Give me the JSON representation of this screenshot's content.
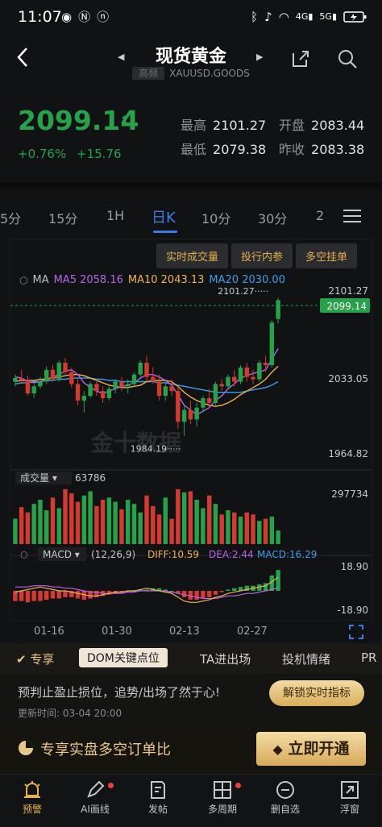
{
  "status_bar": {
    "time": "11:07",
    "left_icons": [
      "eye-icon",
      "nfc-icon",
      "n-icon"
    ],
    "right_icons": [
      "bluetooth-icon",
      "mute-icon",
      "wifi-icon",
      "signal-4g-icon",
      "signal-5g-icon",
      "battery-charging-icon"
    ]
  },
  "header": {
    "title": "现货黄金",
    "tag": "高频",
    "symbol": "XAUUSD.GOODS"
  },
  "quote": {
    "price": "2099.14",
    "change_pct": "+0.76%",
    "change_abs": "+15.76",
    "high_label": "最高",
    "high": "2101.27",
    "open_label": "开盘",
    "open": "2083.44",
    "low_label": "最低",
    "low": "2079.38",
    "prev_close_label": "昨收",
    "prev_close": "2083.38"
  },
  "period_tabs": [
    {
      "label": "5分"
    },
    {
      "label": "15分"
    },
    {
      "label": "1H"
    },
    {
      "label": "日K",
      "active": true
    },
    {
      "label": "10分"
    },
    {
      "label": "30分"
    },
    {
      "label": "2"
    }
  ],
  "chart_chips": [
    "实时成交量",
    "投行内参",
    "多空挂单"
  ],
  "ma_legend": {
    "name": "MA",
    "ma5": "MA5 2058.16",
    "ma10": "MA10 2043.13",
    "ma20": "MA20 2030.00"
  },
  "price_axis": {
    "top": "2101.27",
    "mid": "2033.05",
    "bottom": "1964.82",
    "current": "2099.14",
    "high_marker": "2101.27",
    "low_marker": "1984.19"
  },
  "watermark": "金十数据",
  "volume": {
    "selector": "成交量",
    "value": "63786",
    "axis_max": "297734"
  },
  "macd": {
    "selector": "MACD",
    "params": "(12,26,9)",
    "diff": "DIFF:10.59",
    "dea": "DEA:2.44",
    "macd": "MACD:16.29",
    "axis_top": "18.90",
    "axis_bottom": "-18.90"
  },
  "x_axis": [
    "01-16",
    "01-30",
    "02-13",
    "02-27"
  ],
  "exclusive_bar": {
    "label": "专享",
    "active": "DOM关键点位",
    "items": [
      "TA进出场",
      "投机情绪",
      "PR"
    ]
  },
  "notice": {
    "text": "预判止盈止损位，追势/出场了然于心!",
    "time": "更新时间: 03-04 20:00",
    "button": "解锁实时指标"
  },
  "promo": {
    "text": "专享实盘多空订单比",
    "button": "立即开通"
  },
  "bottom_nav": [
    {
      "label": "预警",
      "icon": "alarm-icon",
      "active": true
    },
    {
      "label": "AI画线",
      "icon": "pen-icon",
      "dot": true
    },
    {
      "label": "发帖",
      "icon": "post-icon"
    },
    {
      "label": "多周期",
      "icon": "grid-icon",
      "dot": true
    },
    {
      "label": "删自选",
      "icon": "minus-circle-icon"
    },
    {
      "label": "浮窗",
      "icon": "float-window-icon"
    }
  ],
  "colors": {
    "up": "#25a24a",
    "down": "#d43a2f",
    "accent": "#3b7be8",
    "gold": "#e4b04f",
    "ma5": "#b765e8",
    "ma10": "#f0b24a",
    "ma20": "#3aa0e8"
  },
  "chart_data": {
    "type": "candlestick",
    "price_range": [
      1964.82,
      2101.27
    ],
    "candles": [
      [
        2030,
        2036,
        2026,
        2033
      ],
      [
        2033,
        2040,
        2028,
        2031
      ],
      [
        2031,
        2035,
        2018,
        2020
      ],
      [
        2020,
        2028,
        2016,
        2026
      ],
      [
        2026,
        2034,
        2024,
        2030
      ],
      [
        2030,
        2043,
        2028,
        2040
      ],
      [
        2040,
        2044,
        2030,
        2032
      ],
      [
        2032,
        2048,
        2030,
        2046
      ],
      [
        2046,
        2050,
        2035,
        2038
      ],
      [
        2038,
        2042,
        2025,
        2028
      ],
      [
        2028,
        2032,
        2010,
        2014
      ],
      [
        2014,
        2022,
        2004,
        2018
      ],
      [
        2018,
        2030,
        2016,
        2028
      ],
      [
        2028,
        2032,
        2018,
        2022
      ],
      [
        2022,
        2026,
        2012,
        2016
      ],
      [
        2016,
        2026,
        2014,
        2024
      ],
      [
        2024,
        2032,
        2020,
        2030
      ],
      [
        2030,
        2034,
        2022,
        2026
      ],
      [
        2026,
        2032,
        2020,
        2028
      ],
      [
        2028,
        2038,
        2026,
        2036
      ],
      [
        2036,
        2048,
        2034,
        2046
      ],
      [
        2046,
        2052,
        2030,
        2034
      ],
      [
        2034,
        2042,
        2028,
        2030
      ],
      [
        2030,
        2036,
        2014,
        2018
      ],
      [
        2018,
        2030,
        2014,
        2026
      ],
      [
        2026,
        2032,
        2018,
        2022
      ],
      [
        2022,
        2026,
        1990,
        1996
      ],
      [
        1996,
        2010,
        1984,
        2006
      ],
      [
        2006,
        2014,
        1994,
        1998
      ],
      [
        1998,
        2012,
        1992,
        2008
      ],
      [
        2008,
        2018,
        2004,
        2016
      ],
      [
        2016,
        2024,
        2008,
        2012
      ],
      [
        2012,
        2030,
        2010,
        2028
      ],
      [
        2028,
        2032,
        2022,
        2026
      ],
      [
        2026,
        2036,
        2024,
        2034
      ],
      [
        2034,
        2040,
        2026,
        2030
      ],
      [
        2030,
        2044,
        2028,
        2042
      ],
      [
        2042,
        2046,
        2030,
        2034
      ],
      [
        2034,
        2040,
        2028,
        2032
      ],
      [
        2032,
        2048,
        2030,
        2046
      ],
      [
        2046,
        2052,
        2038,
        2044
      ],
      [
        2044,
        2082,
        2042,
        2080
      ],
      [
        2083,
        2101,
        2079,
        2099
      ]
    ],
    "ma5": [
      2034,
      2033,
      2030,
      2029,
      2030,
      2032,
      2034,
      2036,
      2039,
      2040,
      2036,
      2029,
      2025,
      2022,
      2020,
      2022,
      2024,
      2026,
      2027,
      2029,
      2033,
      2036,
      2036,
      2034,
      2031,
      2027,
      2019,
      2010,
      2006,
      2002,
      2005,
      2008,
      2014,
      2018,
      2024,
      2028,
      2033,
      2035,
      2037,
      2038,
      2040,
      2049,
      2058
    ],
    "ma10": [
      2030,
      2031,
      2031,
      2031,
      2032,
      2032,
      2033,
      2034,
      2035,
      2036,
      2036,
      2035,
      2033,
      2031,
      2029,
      2027,
      2026,
      2025,
      2025,
      2026,
      2027,
      2030,
      2031,
      2031,
      2031,
      2030,
      2026,
      2021,
      2017,
      2014,
      2012,
      2010,
      2009,
      2010,
      2012,
      2015,
      2019,
      2022,
      2025,
      2028,
      2032,
      2038,
      2043
    ],
    "ma20": [
      2028,
      2029,
      2029,
      2030,
      2030,
      2031,
      2031,
      2032,
      2032,
      2033,
      2033,
      2033,
      2033,
      2032,
      2032,
      2031,
      2031,
      2030,
      2030,
      2030,
      2030,
      2030,
      2030,
      2029,
      2029,
      2028,
      2027,
      2026,
      2025,
      2024,
      2023,
      2022,
      2021,
      2021,
      2021,
      2021,
      2021,
      2022,
      2023,
      2024,
      2025,
      2027,
      2030
    ],
    "volume_range": [
      0,
      297734
    ],
    "volume": [
      120000,
      175000,
      150000,
      190000,
      210000,
      160000,
      220000,
      170000,
      260000,
      240000,
      200000,
      230000,
      250000,
      180000,
      210000,
      220000,
      200000,
      165000,
      210000,
      190000,
      150000,
      230000,
      180000,
      140000,
      220000,
      120000,
      260000,
      245000,
      250000,
      210000,
      170000,
      230000,
      190000,
      140000,
      160000,
      150000,
      130000,
      150000,
      140000,
      110000,
      120000,
      130000,
      63786
    ],
    "macd_range": [
      -18.9,
      18.9
    ],
    "macd_hist": [
      -8,
      -8,
      -9,
      -8,
      -8,
      -7,
      -6,
      -6,
      -5,
      -5,
      -6,
      -7,
      -6,
      -5,
      -4,
      -3,
      -2,
      -1,
      -1,
      0,
      1,
      1,
      2,
      2,
      1,
      0,
      -2,
      -5,
      -7,
      -7,
      -6,
      -5,
      -3,
      -1,
      1,
      2,
      3,
      4,
      4,
      5,
      6,
      12,
      16.29
    ],
    "diff": [
      -1,
      0,
      1,
      2,
      3,
      2,
      1,
      0,
      0,
      -1,
      -2,
      -3,
      -4,
      -4,
      -3,
      -2,
      -1,
      -1,
      0,
      0,
      1,
      2,
      1,
      0,
      -1,
      -2,
      -5,
      -8,
      -9,
      -9,
      -8,
      -7,
      -5,
      -4,
      -2,
      -1,
      0,
      1,
      2,
      3,
      4,
      7,
      10.59
    ],
    "dea": [
      3,
      3,
      3,
      4,
      4,
      4,
      3,
      3,
      2,
      2,
      1,
      0,
      -1,
      -1,
      -2,
      -2,
      -2,
      -2,
      -1,
      -1,
      0,
      0,
      0,
      0,
      0,
      -1,
      -2,
      -3,
      -4,
      -5,
      -6,
      -6,
      -6,
      -5,
      -4,
      -4,
      -3,
      -2,
      -2,
      -1,
      0,
      1,
      2.44
    ]
  }
}
